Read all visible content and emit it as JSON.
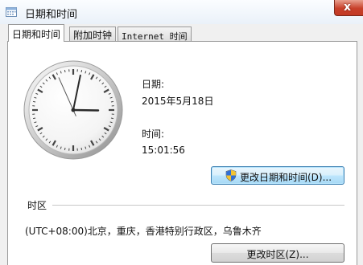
{
  "window": {
    "title": "日期和时间",
    "close_glyph": "x"
  },
  "tabs": [
    {
      "label": "日期和时间",
      "active": true
    },
    {
      "label": "附加时钟",
      "active": false
    },
    {
      "label": "Internet 时间",
      "active": false
    }
  ],
  "clock": {
    "hour": 15,
    "minute": 1,
    "second": 56
  },
  "datetime": {
    "date_label": "日期:",
    "date_value": "2015年5月18日",
    "time_label": "时间:",
    "time_value": "15:01:56",
    "change_button": "更改日期和时间(D)..."
  },
  "timezone": {
    "section_label": "时区",
    "value": "(UTC+08:00)北京，重庆，香港特别行政区，乌鲁木齐",
    "change_button": "更改时区(Z)..."
  },
  "icons": {
    "app": "calendar-clock-icon",
    "uac": "uac-shield-icon",
    "close": "close-icon"
  }
}
